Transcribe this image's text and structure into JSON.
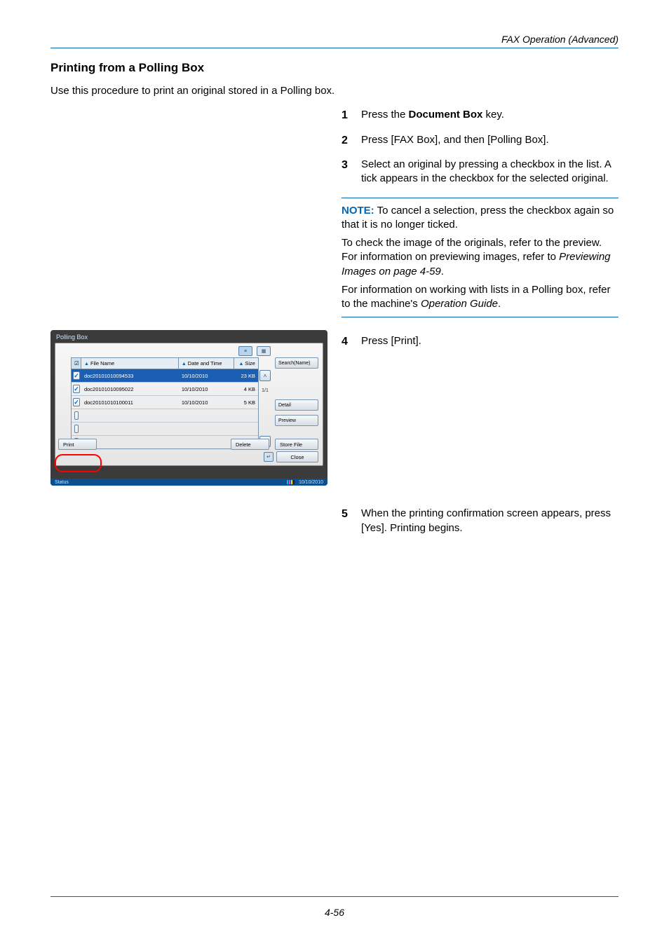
{
  "running_head": "FAX Operation (Advanced)",
  "section_title": "Printing from a Polling Box",
  "intro": "Use this procedure to print an original stored in a Polling box.",
  "steps": {
    "s1_a": "Press the ",
    "s1_b": "Document Box",
    "s1_c": " key.",
    "s2": "Press [FAX Box], and then [Polling Box].",
    "s3": "Select an original by pressing a checkbox in the list. A tick appears in the checkbox for the selected original.",
    "s4": "Press [Print].",
    "s5": "When the printing confirmation screen appears, press [Yes]. Printing begins."
  },
  "note": {
    "label": "NOTE:",
    "p1": " To cancel a selection, press the checkbox again so that it is no longer ticked.",
    "p2a": "To check the image of the originals, refer to the preview. For information on previewing images, refer to ",
    "p2b": "Previewing Images on page 4-59",
    "p2c": ".",
    "p3a": "For information on working with lists in a Polling box, refer to the machine's ",
    "p3b": "Operation Guide",
    "p3c": "."
  },
  "panel": {
    "title": "Polling Box",
    "headers": {
      "checkbox": "☑",
      "name": "File Name",
      "date": "Date and Time",
      "size": "Size"
    },
    "rows": [
      {
        "checked": true,
        "selected": true,
        "name": "doc20101010094533",
        "date": "10/10/2010",
        "size": "23 KB"
      },
      {
        "checked": true,
        "selected": false,
        "name": "doc20101010095022",
        "date": "10/10/2010",
        "size": "4 KB"
      },
      {
        "checked": true,
        "selected": false,
        "name": "doc20101010100011",
        "date": "10/10/2010",
        "size": "5 KB"
      },
      {
        "checked": false,
        "selected": false,
        "name": "",
        "date": "",
        "size": ""
      },
      {
        "checked": false,
        "selected": false,
        "name": "",
        "date": "",
        "size": ""
      },
      {
        "checked": false,
        "selected": false,
        "name": "",
        "date": "",
        "size": ""
      }
    ],
    "page_indicator": "1/1",
    "side": {
      "search": "Search(Name)",
      "detail": "Detail",
      "preview": "Preview"
    },
    "bottom": {
      "print": "Print",
      "delete": "Delete",
      "store": "Store File",
      "close": "Close"
    },
    "status": {
      "label": "Status",
      "date": "10/10/2010"
    }
  },
  "footer": "4-56"
}
